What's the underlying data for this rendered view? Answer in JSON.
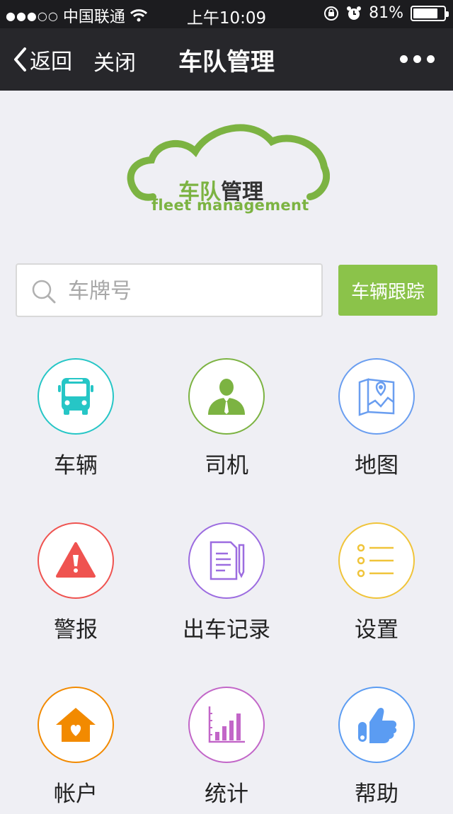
{
  "status_bar": {
    "carrier": "中国联通",
    "signal_dots": "●●●○○",
    "time": "上午10:09",
    "battery": "81%",
    "battery_level": 0.81
  },
  "nav": {
    "back_label": "返回",
    "close_label": "关闭",
    "title": "车队管理"
  },
  "logo": {
    "title_part1": "车队",
    "title_part2": "管理",
    "subtitle": "fleet management",
    "color": "#7cb342"
  },
  "search": {
    "placeholder": "车牌号",
    "value": ""
  },
  "track_button": {
    "label": "车辆跟踪",
    "color": "#8bc34a"
  },
  "menu": [
    {
      "label": "车辆",
      "icon": "bus-icon",
      "color": "#26c6c6"
    },
    {
      "label": "司机",
      "icon": "driver-icon",
      "color": "#7cb342"
    },
    {
      "label": "地图",
      "icon": "map-icon",
      "color": "#6a9ef0"
    },
    {
      "label": "警报",
      "icon": "alert-icon",
      "color": "#ef5350"
    },
    {
      "label": "出车记录",
      "icon": "record-icon",
      "color": "#9c6ce0"
    },
    {
      "label": "设置",
      "icon": "settings-list-icon",
      "color": "#f0c43a"
    },
    {
      "label": "帐户",
      "icon": "account-home-icon",
      "color": "#f28a00"
    },
    {
      "label": "统计",
      "icon": "stats-icon",
      "color": "#c266c8"
    },
    {
      "label": "帮助",
      "icon": "thumbs-up-icon",
      "color": "#5b9cf2"
    }
  ]
}
